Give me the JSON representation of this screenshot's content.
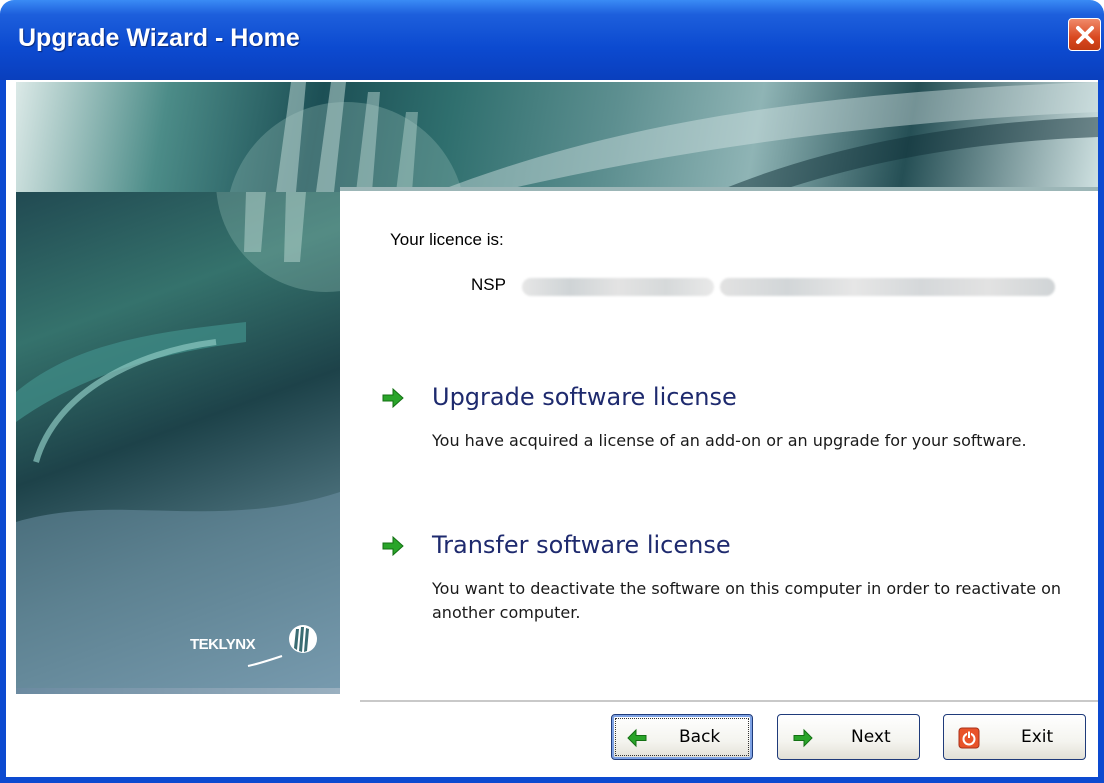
{
  "window": {
    "title": "Upgrade Wizard - Home",
    "close_icon": "close-icon"
  },
  "license": {
    "label": "Your licence is:",
    "prefix": "NSP"
  },
  "options": [
    {
      "title": "Upgrade software license",
      "description": "You have acquired a license of an add-on or an upgrade for your software.",
      "icon": "green-arrow-icon"
    },
    {
      "title": "Transfer software license",
      "description": "You want to deactivate the software on this computer in order to reactivate on another computer.",
      "icon": "green-arrow-icon"
    }
  ],
  "brand": {
    "logo_text": "TEKLYNX"
  },
  "buttons": {
    "back": "Back",
    "next": "Next",
    "exit": "Exit"
  },
  "colors": {
    "titlebar": "#0c4ad0",
    "close": "#d9481f",
    "option_title": "#1e2a6e",
    "arrow_green": "#2aa52a"
  }
}
